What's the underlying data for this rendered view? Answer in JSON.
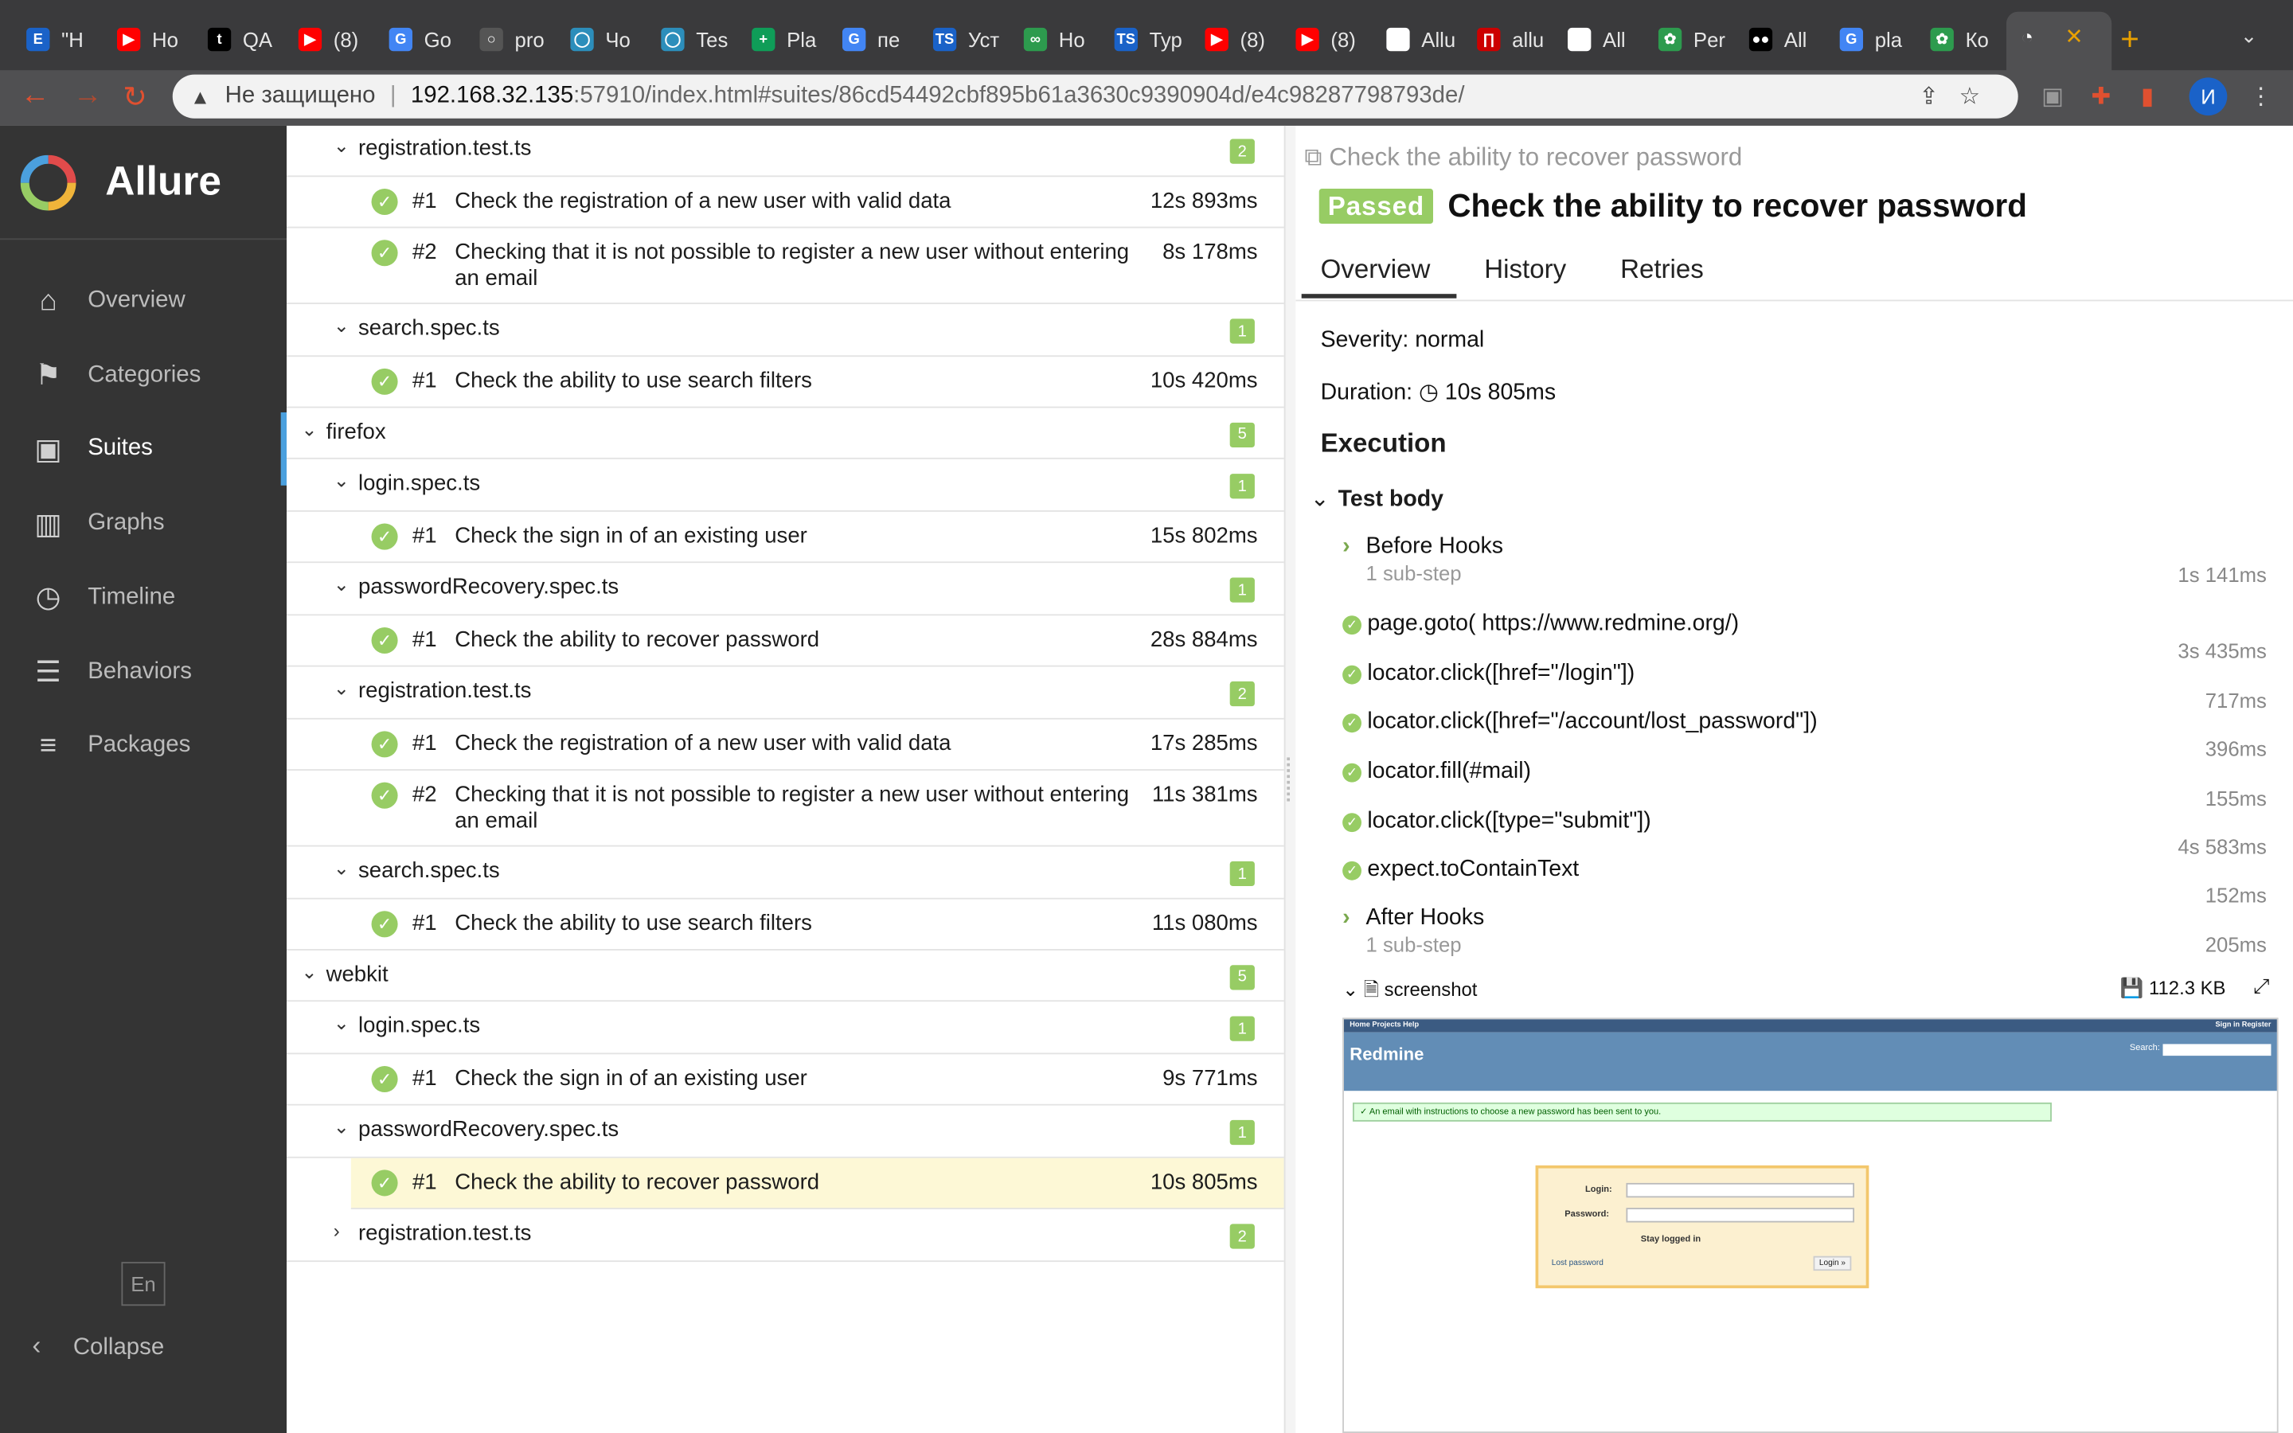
{
  "browser": {
    "tabs": [
      {
        "icon": "E",
        "label": "\"Н",
        "color": "#1a62c8"
      },
      {
        "icon": "▶",
        "label": "Но",
        "color": "#ff0000"
      },
      {
        "icon": "t",
        "label": "QA",
        "color": "#000000"
      },
      {
        "icon": "▶",
        "label": "(8)",
        "color": "#ff0000"
      },
      {
        "icon": "G",
        "label": "Go",
        "color": "#4285f4"
      },
      {
        "icon": "○",
        "label": "pro",
        "color": "#555555"
      },
      {
        "icon": "◯",
        "label": "Чо",
        "color": "#2c8ebb"
      },
      {
        "icon": "◯",
        "label": "Tes",
        "color": "#2c8ebb"
      },
      {
        "icon": "+",
        "label": "Pla",
        "color": "#0f9d58"
      },
      {
        "icon": "G",
        "label": "пе",
        "color": "#4285f4"
      },
      {
        "icon": "TS",
        "label": "Уст",
        "color": "#1a62c8"
      },
      {
        "icon": "∞",
        "label": "Ho",
        "color": "#2d9b4e"
      },
      {
        "icon": "TS",
        "label": "Тур",
        "color": "#1a62c8"
      },
      {
        "icon": "▶",
        "label": "(8)",
        "color": "#ff0000"
      },
      {
        "icon": "▶",
        "label": "(8)",
        "color": "#ff0000"
      },
      {
        "icon": "◔",
        "label": "Allu",
        "color": "#ffffff"
      },
      {
        "icon": "∏",
        "label": "allu",
        "color": "#cc0000"
      },
      {
        "icon": "◔",
        "label": "All",
        "color": "#ffffff"
      },
      {
        "icon": "✿",
        "label": "Per",
        "color": "#2d9b4e"
      },
      {
        "icon": "●●",
        "label": "All",
        "color": "#000000"
      },
      {
        "icon": "G",
        "label": "pla",
        "color": "#4285f4"
      },
      {
        "icon": "✿",
        "label": "Ко",
        "color": "#2d9b4e"
      }
    ],
    "active_tab_close": "✕",
    "new_tab": "+",
    "address": {
      "insecure_label": "Не защищено",
      "host": "192.168.32.135",
      "path": ":57910/index.html#suites/86cd54492cbf895b61a3630c9390904d/e4c98287798793de/"
    },
    "profile_initial": "И"
  },
  "sidebar": {
    "brand": "Allure",
    "items": [
      {
        "label": "Overview",
        "icon": "home-icon"
      },
      {
        "label": "Categories",
        "icon": "flag-icon"
      },
      {
        "label": "Suites",
        "icon": "briefcase-icon"
      },
      {
        "label": "Graphs",
        "icon": "bar-chart-icon"
      },
      {
        "label": "Timeline",
        "icon": "clock-icon"
      },
      {
        "label": "Behaviors",
        "icon": "list-icon"
      },
      {
        "label": "Packages",
        "icon": "align-left-icon"
      }
    ],
    "active": "Suites",
    "language": "En",
    "collapse": "Collapse"
  },
  "tree": {
    "rows": [
      {
        "kind": "group",
        "level": 2,
        "name": "registration.test.ts",
        "count": "2",
        "expanded": true
      },
      {
        "kind": "case",
        "num": "#1",
        "title": "Check the registration of a new user with valid data",
        "duration": "12s 893ms"
      },
      {
        "kind": "case",
        "num": "#2",
        "title": "Checking that it is not possible to register a new user without entering an email",
        "duration": "8s 178ms"
      },
      {
        "kind": "group",
        "level": 2,
        "name": "search.spec.ts",
        "count": "1",
        "expanded": true
      },
      {
        "kind": "case",
        "num": "#1",
        "title": "Check the ability to use search filters",
        "duration": "10s 420ms"
      },
      {
        "kind": "group",
        "level": 1,
        "name": "firefox",
        "count": "5",
        "expanded": true
      },
      {
        "kind": "group",
        "level": 2,
        "name": "login.spec.ts",
        "count": "1",
        "expanded": true
      },
      {
        "kind": "case",
        "num": "#1",
        "title": "Check the sign in of an existing user",
        "duration": "15s 802ms"
      },
      {
        "kind": "group",
        "level": 2,
        "name": "passwordRecovery.spec.ts",
        "count": "1",
        "expanded": true
      },
      {
        "kind": "case",
        "num": "#1",
        "title": "Check the ability to recover password",
        "duration": "28s 884ms"
      },
      {
        "kind": "group",
        "level": 2,
        "name": "registration.test.ts",
        "count": "2",
        "expanded": true
      },
      {
        "kind": "case",
        "num": "#1",
        "title": "Check the registration of a new user with valid data",
        "duration": "17s 285ms"
      },
      {
        "kind": "case",
        "num": "#2",
        "title": "Checking that it is not possible to register a new user without entering an email",
        "duration": "11s 381ms"
      },
      {
        "kind": "group",
        "level": 2,
        "name": "search.spec.ts",
        "count": "1",
        "expanded": true
      },
      {
        "kind": "case",
        "num": "#1",
        "title": "Check the ability to use search filters",
        "duration": "11s 080ms"
      },
      {
        "kind": "group",
        "level": 1,
        "name": "webkit",
        "count": "5",
        "expanded": true
      },
      {
        "kind": "group",
        "level": 2,
        "name": "login.spec.ts",
        "count": "1",
        "expanded": true
      },
      {
        "kind": "case",
        "num": "#1",
        "title": "Check the sign in of an existing user",
        "duration": "9s 771ms"
      },
      {
        "kind": "group",
        "level": 2,
        "name": "passwordRecovery.spec.ts",
        "count": "1",
        "expanded": true
      },
      {
        "kind": "case",
        "num": "#1",
        "title": "Check the ability to recover password",
        "duration": "10s 805ms",
        "selected": true
      },
      {
        "kind": "group",
        "level": 2,
        "name": "registration.test.ts",
        "count": "2",
        "expanded": false
      }
    ]
  },
  "details": {
    "breadcrumb": "Check the ability to recover password",
    "status": "Passed",
    "title": "Check the ability to recover password",
    "tabs": [
      "Overview",
      "History",
      "Retries"
    ],
    "severity": "Severity: normal",
    "duration_label": "Duration:",
    "duration": "10s 805ms",
    "execution": "Execution",
    "test_body": "Test body",
    "steps": [
      {
        "kind": "group",
        "name": "Before Hooks",
        "sub": "1 sub-step",
        "duration": "1s 141ms"
      },
      {
        "kind": "step",
        "name": "page.goto( https://www.redmine.org/)",
        "duration": "3s 435ms"
      },
      {
        "kind": "step",
        "name": "locator.click([href=\"/login\"])",
        "duration": "717ms"
      },
      {
        "kind": "step",
        "name": "locator.click([href=\"/account/lost_password\"])",
        "duration": "396ms"
      },
      {
        "kind": "step",
        "name": "locator.fill(#mail)",
        "duration": "155ms"
      },
      {
        "kind": "step",
        "name": "locator.click([type=\"submit\"])",
        "duration": "4s 583ms"
      },
      {
        "kind": "step",
        "name": "expect.toContainText",
        "duration": "152ms"
      },
      {
        "kind": "group",
        "name": "After Hooks",
        "sub": "1 sub-step",
        "duration": "205ms"
      }
    ],
    "attachment": {
      "name": "screenshot",
      "size": "112.3 KB"
    },
    "screenshot": {
      "top_left": "Home  Projects  Help",
      "top_right": "Sign in  Register",
      "site_name": "Redmine",
      "search_label": "Search:",
      "flash": "An email with instructions to choose a new password has been sent to you.",
      "login_label": "Login:",
      "password_label": "Password:",
      "stay_logged": "Stay logged in",
      "lost_password": "Lost password",
      "login_button": "Login »"
    }
  }
}
